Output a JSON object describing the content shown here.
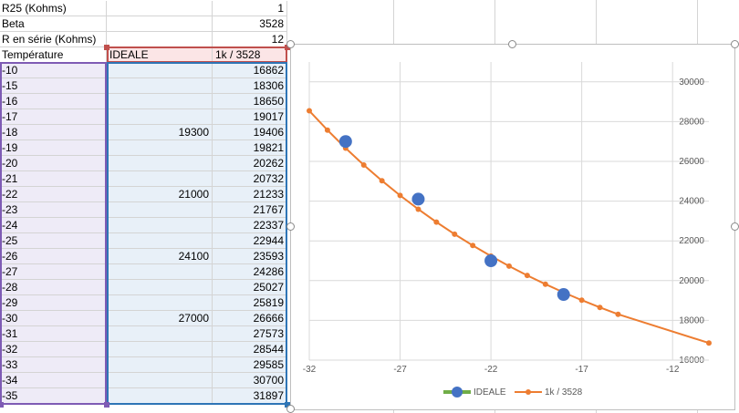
{
  "params": [
    {
      "label": "R25 (Kohms)",
      "value": "1"
    },
    {
      "label": "Beta",
      "value": "3528"
    },
    {
      "label": "R en série (Kohms)",
      "value": "12"
    }
  ],
  "table": {
    "headers": [
      "Température",
      "IDEALE",
      "1k / 3528"
    ],
    "rows": [
      [
        "-10",
        "",
        "16862"
      ],
      [
        "-15",
        "",
        "18306"
      ],
      [
        "-16",
        "",
        "18650"
      ],
      [
        "-17",
        "",
        "19017"
      ],
      [
        "-18",
        "19300",
        "19406"
      ],
      [
        "-19",
        "",
        "19821"
      ],
      [
        "-20",
        "",
        "20262"
      ],
      [
        "-21",
        "",
        "20732"
      ],
      [
        "-22",
        "21000",
        "21233"
      ],
      [
        "-23",
        "",
        "21767"
      ],
      [
        "-24",
        "",
        "22337"
      ],
      [
        "-25",
        "",
        "22944"
      ],
      [
        "-26",
        "24100",
        "23593"
      ],
      [
        "-27",
        "",
        "24286"
      ],
      [
        "-28",
        "",
        "25027"
      ],
      [
        "-29",
        "",
        "25819"
      ],
      [
        "-30",
        "27000",
        "26666"
      ],
      [
        "-31",
        "",
        "27573"
      ],
      [
        "-32",
        "",
        "28544"
      ],
      [
        "-33",
        "",
        "29585"
      ],
      [
        "-34",
        "",
        "30700"
      ],
      [
        "-35",
        "",
        "31897"
      ]
    ]
  },
  "chart_data": {
    "type": "scatter",
    "x_ticks": [
      "-32",
      "-27",
      "-22",
      "-17",
      "-12"
    ],
    "y_ticks": [
      "16000",
      "18000",
      "20000",
      "22000",
      "24000",
      "26000",
      "28000",
      "30000"
    ],
    "xlim": [
      -32,
      -10
    ],
    "ylim": [
      16000,
      31000
    ],
    "grid": true,
    "legend_position": "bottom",
    "series": [
      {
        "name": "IDEALE",
        "style": "markers",
        "color": "#4472c4",
        "legend_line_color": "#70ad47",
        "x": [
          -18,
          -22,
          -26,
          -30
        ],
        "y": [
          19300,
          21000,
          24100,
          27000
        ]
      },
      {
        "name": "1k / 3528",
        "style": "line-markers",
        "color": "#ed7d31",
        "x": [
          -10,
          -15,
          -16,
          -17,
          -18,
          -19,
          -20,
          -21,
          -22,
          -23,
          -24,
          -25,
          -26,
          -27,
          -28,
          -29,
          -30,
          -31,
          -32
        ],
        "y": [
          16862,
          18306,
          18650,
          19017,
          19406,
          19821,
          20262,
          20732,
          21233,
          21767,
          22337,
          22944,
          23593,
          24286,
          25027,
          25819,
          26666,
          27573,
          28544
        ]
      }
    ]
  }
}
